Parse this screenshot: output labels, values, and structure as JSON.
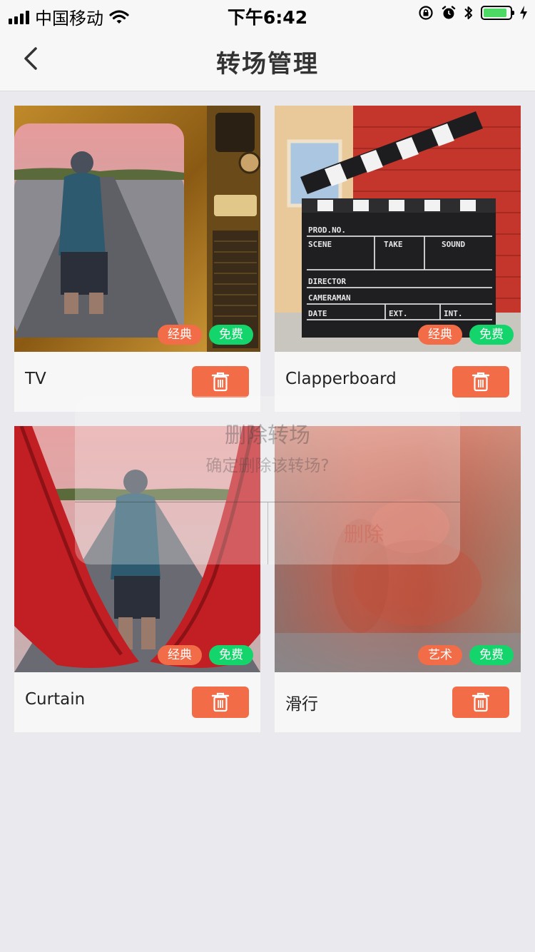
{
  "status_bar": {
    "carrier": "中国移动",
    "time": "下午6:42",
    "battery_level": 0.9,
    "icons": [
      "signal-icon",
      "wifi-icon",
      "rotation-lock-icon",
      "alarm-icon",
      "bluetooth-icon",
      "battery-icon",
      "charging-icon"
    ]
  },
  "nav": {
    "title": "转场管理",
    "back_icon": "chevron-left-icon"
  },
  "colors": {
    "accent": "#f26c47",
    "tag_green": "#13d56b",
    "tag_orange": "#f26c47"
  },
  "transitions": [
    {
      "name": "TV",
      "tags": [
        "经典",
        "免费"
      ]
    },
    {
      "name": "Clapperboard",
      "tags": [
        "经典",
        "免费"
      ]
    },
    {
      "name": "Curtain",
      "tags": [
        "经典",
        "免费"
      ]
    },
    {
      "name": "滑行",
      "tags": [
        "艺术",
        "免费"
      ]
    }
  ],
  "clapperboard_labels": [
    "PROD.NO.",
    "SCENE",
    "TAKE",
    "SOUND",
    "DIRECTOR",
    "CAMERAMAN",
    "DATE",
    "EXT.",
    "INT."
  ],
  "dialog": {
    "title": "删除转场",
    "message": "确定删除该转场?",
    "cancel_label": "",
    "confirm_label": "删除"
  }
}
